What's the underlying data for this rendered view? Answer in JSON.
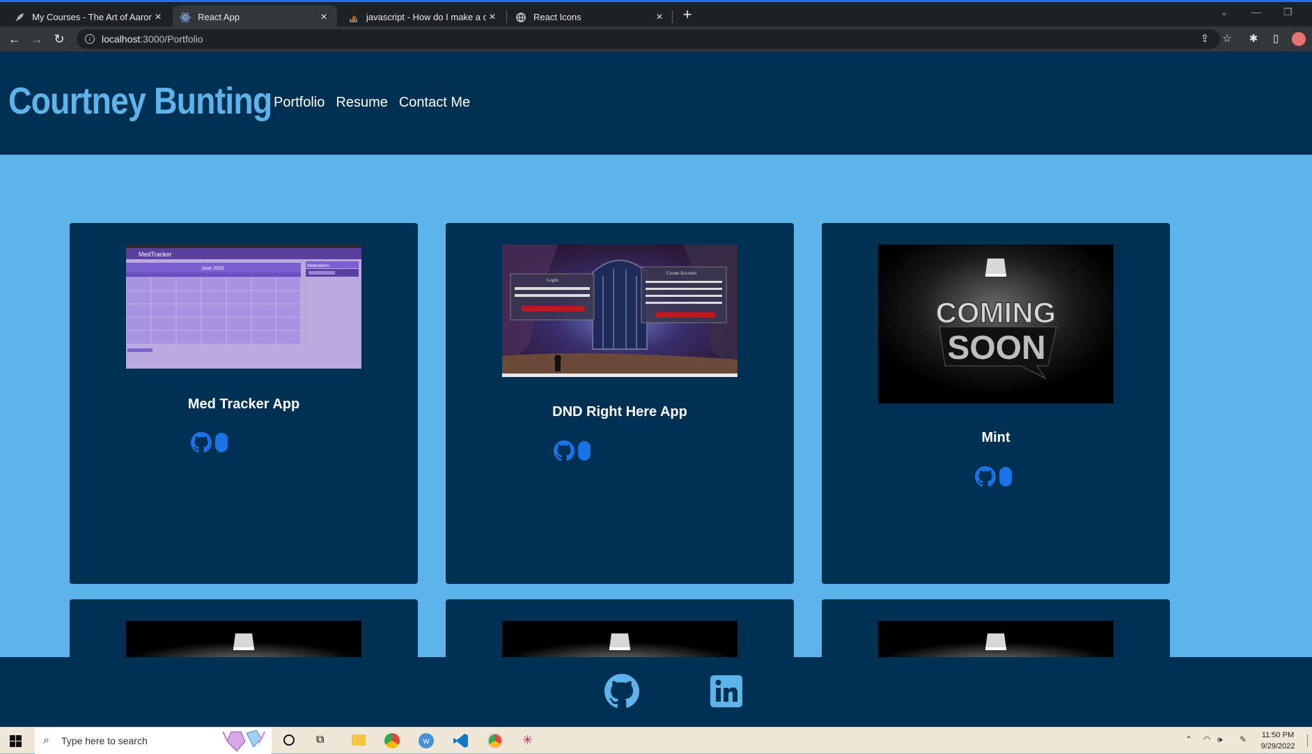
{
  "browser": {
    "tabs": [
      {
        "title": "My Courses - The Art of Aaron Bl",
        "icon": "feather-icon"
      },
      {
        "title": "React App",
        "icon": "react-icon"
      },
      {
        "title": "javascript - How do I make a com",
        "icon": "stackoverflow-icon"
      },
      {
        "title": "React Icons",
        "icon": "globe-icon"
      }
    ],
    "url_host": "localhost",
    "url_path": ":3000/Portfolio"
  },
  "site": {
    "brand": "Courtney Bunting",
    "nav": [
      "Portfolio",
      "Resume",
      "Contact Me"
    ]
  },
  "projects": [
    {
      "name": "Med Tracker App",
      "image": "medtracker-screenshot"
    },
    {
      "name": "DND Right Here App",
      "image": "dnd-screenshot"
    },
    {
      "name": "Mint",
      "image": "coming-soon"
    }
  ],
  "thumbs": {
    "med": {
      "app_title": "MedTracker",
      "month": "June 2022",
      "side_title": "Medications"
    },
    "dnd": {
      "login": "Login",
      "create": "Create Account"
    },
    "soon": {
      "line1": "COMING",
      "line2": "SOON"
    }
  },
  "footer": {
    "icons": [
      "github-icon",
      "linkedin-icon"
    ]
  },
  "taskbar": {
    "search_placeholder": "Type here to search",
    "time": "11:50 PM",
    "date": "9/29/2022"
  },
  "colors": {
    "navy": "#003153",
    "sky": "#5db3ea",
    "link_blue": "#1a73e8"
  }
}
